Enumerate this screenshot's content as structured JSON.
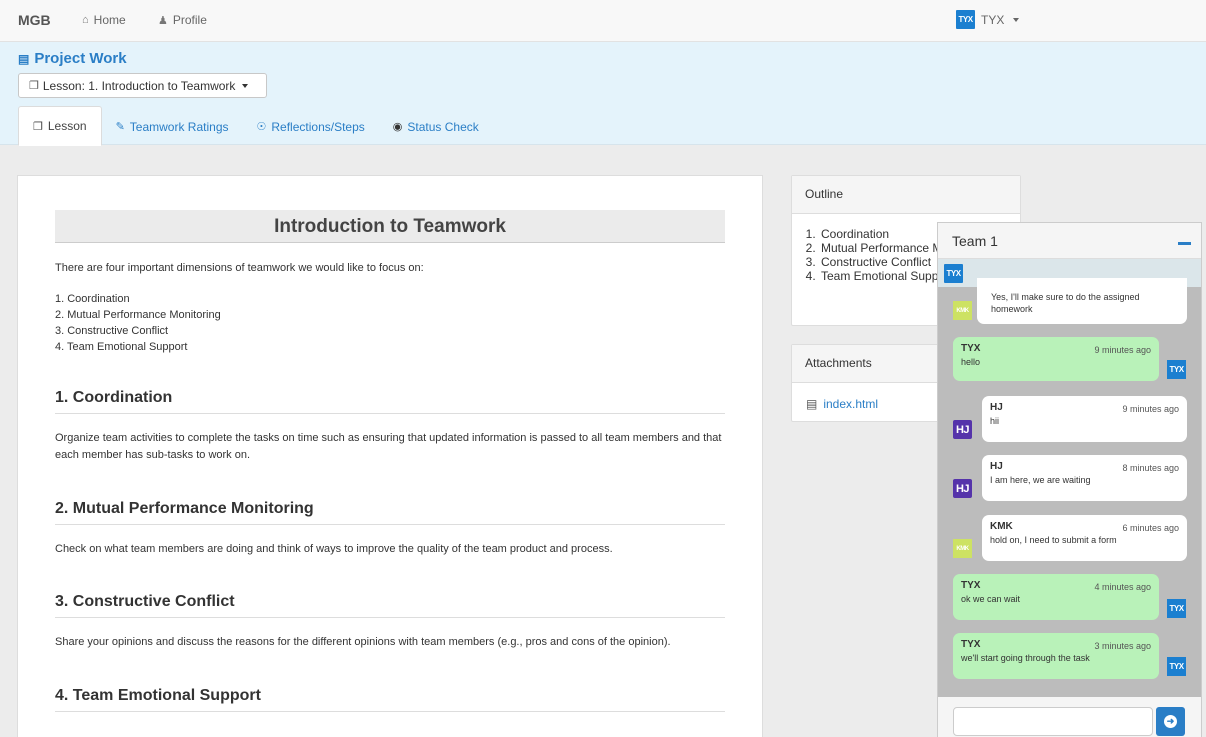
{
  "navbar": {
    "brand": "MGB",
    "home": "Home",
    "profile": "Profile",
    "user_badge": "TYX",
    "user": "TYX"
  },
  "project": {
    "title": "Project Work",
    "lesson_select": "Lesson: 1. Introduction to Teamwork",
    "tabs": [
      "Lesson",
      "Teamwork Ratings",
      "Reflections/Steps",
      "Status Check"
    ]
  },
  "lesson": {
    "title": "Introduction to Teamwork",
    "intro": "There are four important dimensions of teamwork we would like to focus on:",
    "list": [
      "1. Coordination",
      "2. Mutual Performance Monitoring",
      "3. Constructive Conflict",
      "4. Team Emotional Support"
    ],
    "sections": [
      {
        "heading": "1. Coordination",
        "body": "Organize team activities to complete the tasks on time such as ensuring that updated information is passed to all team members and that each member has sub-tasks to work on."
      },
      {
        "heading": "2. Mutual Performance Monitoring",
        "body": "Check on what team members are doing and think of ways to improve the quality of the team product and process."
      },
      {
        "heading": "3. Constructive Conflict",
        "body": "Share your opinions and discuss the reasons for the different opinions with team members (e.g., pros and cons of the opinion)."
      },
      {
        "heading": "4. Team Emotional Support",
        "body": ""
      }
    ]
  },
  "outline": {
    "title": "Outline",
    "items": [
      "Coordination",
      "Mutual Performance Monitoring",
      "Constructive Conflict",
      "Team Emotional Support"
    ]
  },
  "attachments": {
    "title": "Attachments",
    "file": "index.html"
  },
  "chat": {
    "title": "Team 1",
    "header_badge": "TYX",
    "messages": [
      {
        "name": "",
        "time": "",
        "text": "Yes, I'll make sure to do the assigned homework",
        "avatar": "KMK"
      },
      {
        "name": "TYX",
        "time": "9 minutes ago",
        "text": "hello",
        "avatar": "TYX"
      },
      {
        "name": "HJ",
        "time": "9 minutes ago",
        "text": "hii",
        "avatar": "HJ"
      },
      {
        "name": "HJ",
        "time": "8 minutes ago",
        "text": "I am here, we are waiting",
        "avatar": "HJ"
      },
      {
        "name": "KMK",
        "time": "6 minutes ago",
        "text": "hold on, I need to submit a form",
        "avatar": "KMK"
      },
      {
        "name": "TYX",
        "time": "4 minutes ago",
        "text": "ok we can wait",
        "avatar": "TYX"
      },
      {
        "name": "TYX",
        "time": "3 minutes ago",
        "text": "we'll start going through the task",
        "avatar": "TYX"
      }
    ]
  },
  "colors": {
    "accent": "#2a7ec6",
    "bubble_self": "#b9f2b9",
    "bubble_other": "#ffffff",
    "project_bg": "#e4f3fb"
  }
}
